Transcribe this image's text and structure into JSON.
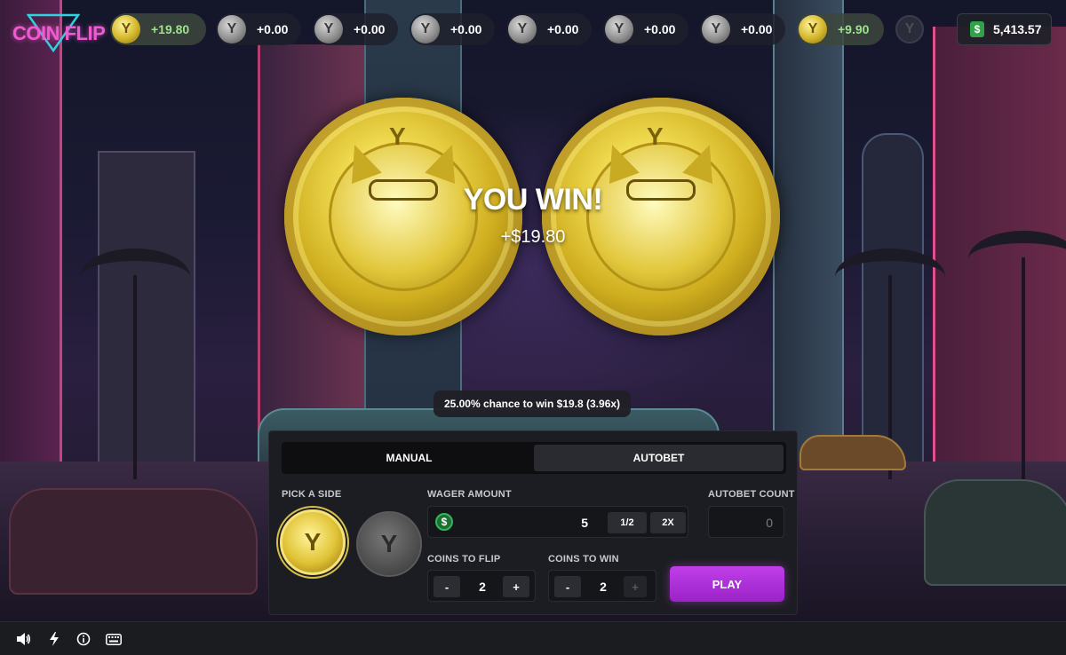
{
  "app": {
    "logo_text": "COIN FLIP"
  },
  "history": [
    {
      "side": "gold",
      "value": "+19.80",
      "win": true
    },
    {
      "side": "silver",
      "value": "+0.00",
      "win": false
    },
    {
      "side": "silver",
      "value": "+0.00",
      "win": false
    },
    {
      "side": "silver",
      "value": "+0.00",
      "win": false
    },
    {
      "side": "silver",
      "value": "+0.00",
      "win": false
    },
    {
      "side": "silver",
      "value": "+0.00",
      "win": false
    },
    {
      "side": "silver",
      "value": "+0.00",
      "win": false
    },
    {
      "side": "gold",
      "value": "+9.90",
      "win": true
    },
    {
      "side": "dim",
      "value": "",
      "win": false
    }
  ],
  "balance": {
    "currency_icon": "$",
    "value": "5,413.57"
  },
  "result": {
    "title": "YOU WIN!",
    "amount": "+$19.80"
  },
  "chance_text": "25.00% chance to win $19.8 (3.96x)",
  "tabs": {
    "manual": "MANUAL",
    "autobet": "AUTOBET",
    "active": "manual"
  },
  "controls": {
    "pick_side_label": "PICK A SIDE",
    "wager_label": "WAGER AMOUNT",
    "wager_value": "5",
    "wager_currency_icon": "$",
    "half_label": "1/2",
    "double_label": "2X",
    "autobet_count_label": "AUTOBET COUNT",
    "autobet_count_value": "0",
    "coins_to_flip_label": "COINS TO FLIP",
    "coins_to_flip_value": "2",
    "coins_to_win_label": "COINS TO WIN",
    "coins_to_win_value": "2",
    "minus": "-",
    "plus": "+",
    "play_label": "PLAY",
    "selected_side": "gold"
  },
  "coin_glyph": "Y",
  "colors": {
    "accent_purple": "#b430e0",
    "win_green": "#9ae48a",
    "gold": "#e0c235",
    "logo_pink": "#f05ad0"
  },
  "icons": {
    "sound": "speaker-icon",
    "fast": "lightning-icon",
    "info": "info-icon",
    "keyboard": "keyboard-icon"
  }
}
